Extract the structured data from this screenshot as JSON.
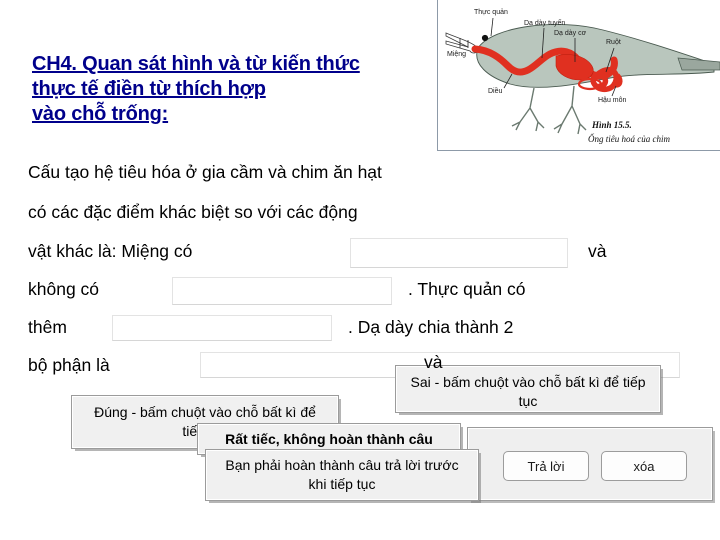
{
  "slide": {
    "title_lines": [
      "CH4. Quan sát hình và từ kiến thức",
      "thực tế điền từ thích hợp",
      "vào chỗ trống:"
    ],
    "title_color": "#00008B",
    "body_segments": {
      "line1": "Cấu tạo hệ tiêu hóa ở gia cầm và chim ăn hạt",
      "line2": "có các đặc  điểm khác biệt so với các động",
      "line3a": "vật khác là: Miệng có",
      "line3b": "và",
      "line4a": "không có",
      "line4b": ". Thực quản có",
      "line5a": "thêm",
      "line5b": ". Dạ dày chia  thành 2",
      "line6a": "bộ phận là",
      "line6b": "và"
    }
  },
  "blanks": [
    {
      "name": "blank-mieng-co",
      "value": "",
      "placeholder": ""
    },
    {
      "name": "blank-khong-co",
      "value": "",
      "placeholder": ""
    },
    {
      "name": "blank-them",
      "value": "",
      "placeholder": ""
    },
    {
      "name": "blank-bo-phan-la",
      "value": "",
      "placeholder": ""
    }
  ],
  "diagram": {
    "labels": {
      "esophagus": "Thực quản",
      "glandular_stomach": "Dạ dày tuyến",
      "muscular_stomach": "Dạ dày cơ",
      "intestine": "Ruột",
      "mouth": "Miệng",
      "crop": "Diều",
      "anus": "Hậu môn"
    },
    "caption_line1": "Hình 15.5.",
    "caption_line2": "Ống tiêu hoá  của chim",
    "body_color": "#b9c6bd",
    "tract_color": "#e03020"
  },
  "feedback": {
    "correct": "Đúng - bấm chuột vào chỗ bất kì để tiếp tục",
    "incorrect": "Sai - bấm chuột vào chỗ bất kì để tiếp tục",
    "incomplete_title": "Rất tiếc, không hoàn thành câu",
    "incomplete_body": "Bạn phải hoàn thành câu trả lời trước khi tiếp tục"
  },
  "buttons": {
    "answer": "Trả lời",
    "clear": "xóa"
  }
}
